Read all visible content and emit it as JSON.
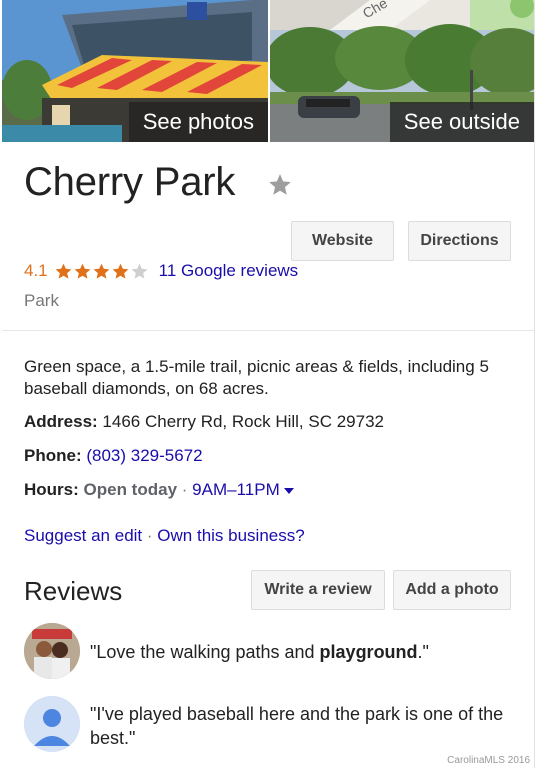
{
  "photos": {
    "left_label": "See photos",
    "right_label": "See outside",
    "map_road_label": "Che"
  },
  "place": {
    "name": "Cherry Park",
    "rating": "4.1",
    "rating_value": 4.1,
    "rating_max": 5,
    "reviews_link": "11 Google reviews",
    "category": "Park"
  },
  "actions": {
    "website": "Website",
    "directions": "Directions"
  },
  "details": {
    "description": "Green space, a 1.5-mile trail, picnic areas & fields, including 5 baseball diamonds, on 68 acres.",
    "address_label": "Address:",
    "address": "1466 Cherry Rd, Rock Hill, SC 29732",
    "phone_label": "Phone:",
    "phone": "(803) 329-5672",
    "hours_label": "Hours:",
    "hours_status": "Open today",
    "hours_sep": "·",
    "hours_time": "9AM–11PM"
  },
  "edit_links": {
    "suggest": "Suggest an edit",
    "sep": "·",
    "own": "Own this business?"
  },
  "reviews": {
    "title": "Reviews",
    "write": "Write a review",
    "add_photo": "Add a photo",
    "items": [
      {
        "open_quote": "\"",
        "text_before": "Love the walking paths and ",
        "bold": "playground",
        "text_after": ".\""
      },
      {
        "text": "\"I've played baseball here and the park is one of the best.\""
      }
    ]
  },
  "watermark": "CarolinaMLS 2016",
  "colors": {
    "rating_orange": "#e0701a",
    "link_blue": "#1a0dab",
    "star_gray": "#9e9e9e"
  }
}
